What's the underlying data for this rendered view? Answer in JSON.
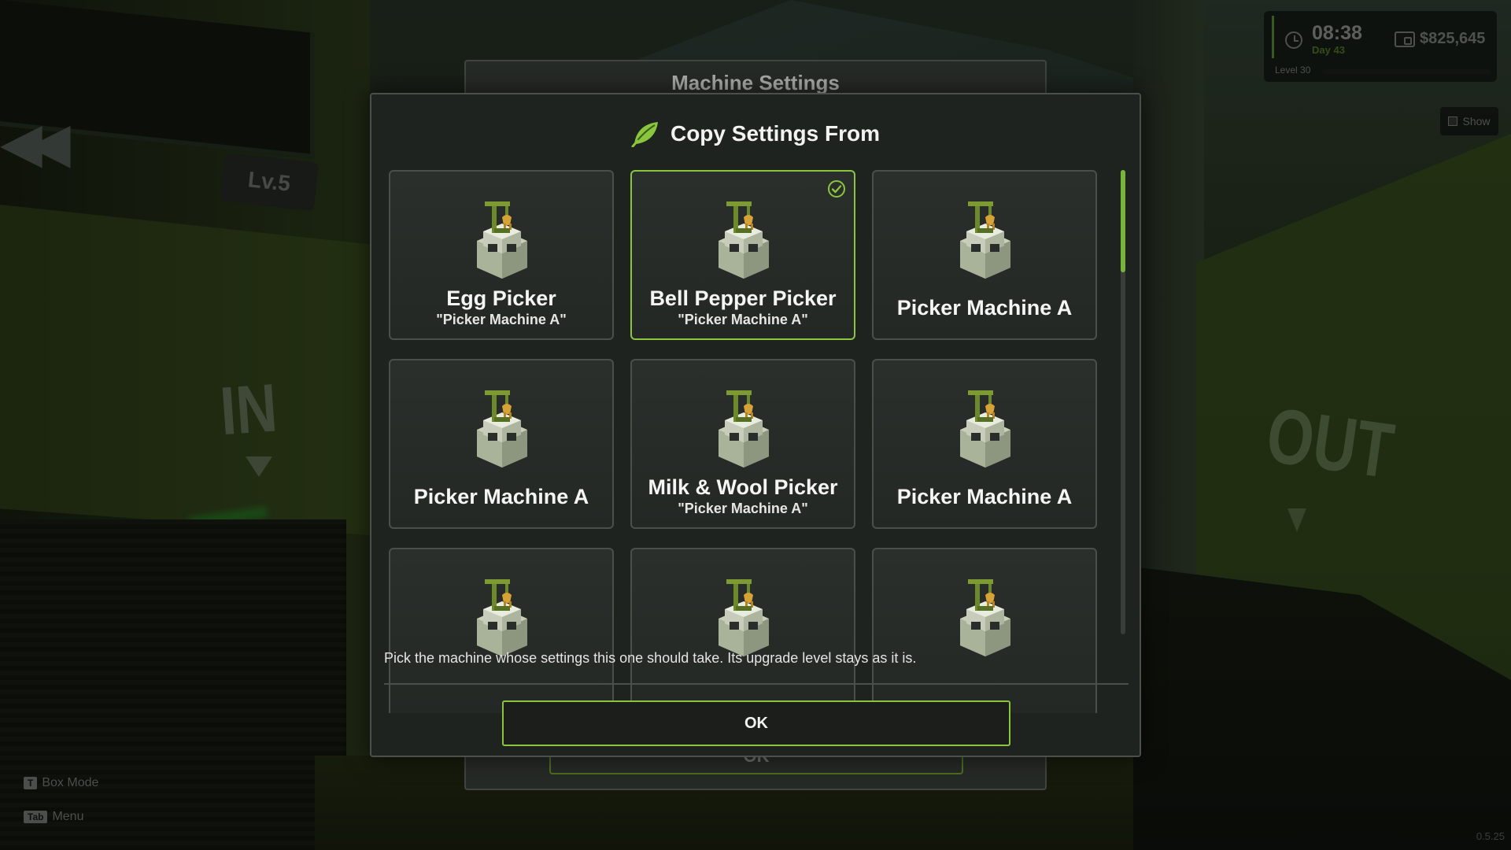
{
  "background": {
    "level_badge": "Lv.5",
    "in_label": "IN",
    "out_label": "OUT",
    "back_modal_title": "Machine Settings",
    "back_modal_ok": "OK"
  },
  "hud": {
    "time": "08:38",
    "day": "Day 43",
    "money": "$825,645",
    "level": "Level 30",
    "level_progress": 0.0,
    "show_label": "Show"
  },
  "hints": {
    "box_mode_key": "T",
    "box_mode_label": "Box Mode",
    "menu_key": "Tab",
    "menu_label": "Menu"
  },
  "version": "0.5.25",
  "modal": {
    "title": "Copy Settings From",
    "title_icon": "leaf-icon",
    "description": "Pick the machine whose settings this one should take. Its upgrade level stays as it is.",
    "ok_label": "OK",
    "accent_color": "#8ac53e",
    "selected_index": 1,
    "machines": [
      {
        "name": "Egg Picker",
        "sub": "\"Picker Machine A\""
      },
      {
        "name": "Bell Pepper Picker",
        "sub": "\"Picker Machine A\""
      },
      {
        "name": "Picker Machine A",
        "sub": ""
      },
      {
        "name": "Picker Machine A",
        "sub": ""
      },
      {
        "name": "Milk & Wool Picker",
        "sub": "\"Picker Machine A\""
      },
      {
        "name": "Picker Machine A",
        "sub": ""
      },
      {
        "name": "",
        "sub": ""
      },
      {
        "name": "",
        "sub": ""
      },
      {
        "name": "",
        "sub": ""
      }
    ]
  }
}
